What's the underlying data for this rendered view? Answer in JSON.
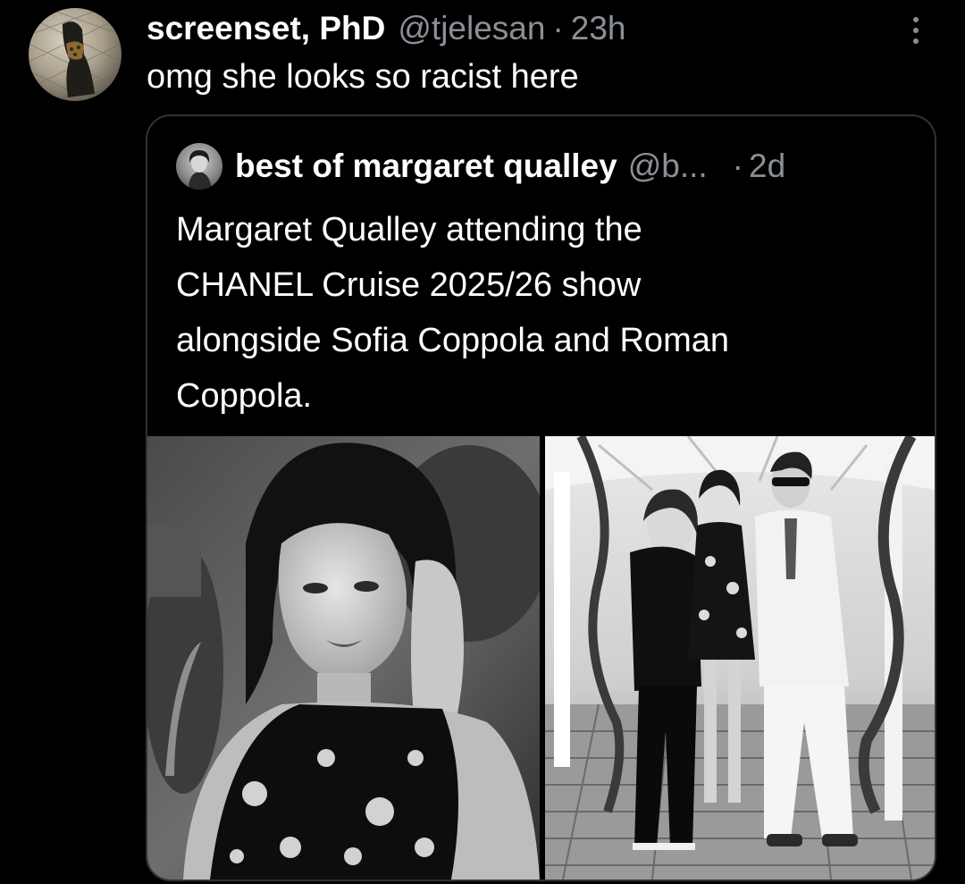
{
  "tweet": {
    "display_name": "screenset, PhD",
    "handle": "@tjelesan",
    "separator": "·",
    "timestamp": "23h",
    "text": "omg she looks so racist here",
    "avatar_icon": "avatar-photo",
    "menu_icon": "more-options-icon"
  },
  "quoted_tweet": {
    "display_name": "best of margaret qualley",
    "handle": "@b...",
    "separator": "·",
    "timestamp": "2d",
    "text_lines": [
      "Margaret Qualley attending the",
      "CHANEL Cruise 2025/26 show",
      "alongside Sofia Coppola and Roman",
      "Coppola."
    ],
    "media": [
      {
        "kind": "photo",
        "tone": "black-and-white"
      },
      {
        "kind": "photo",
        "tone": "black-and-white"
      }
    ]
  },
  "colors": {
    "background": "#000000",
    "primary_text": "#ffffff",
    "secondary_text": "#8b9096",
    "border": "#2f3336"
  }
}
